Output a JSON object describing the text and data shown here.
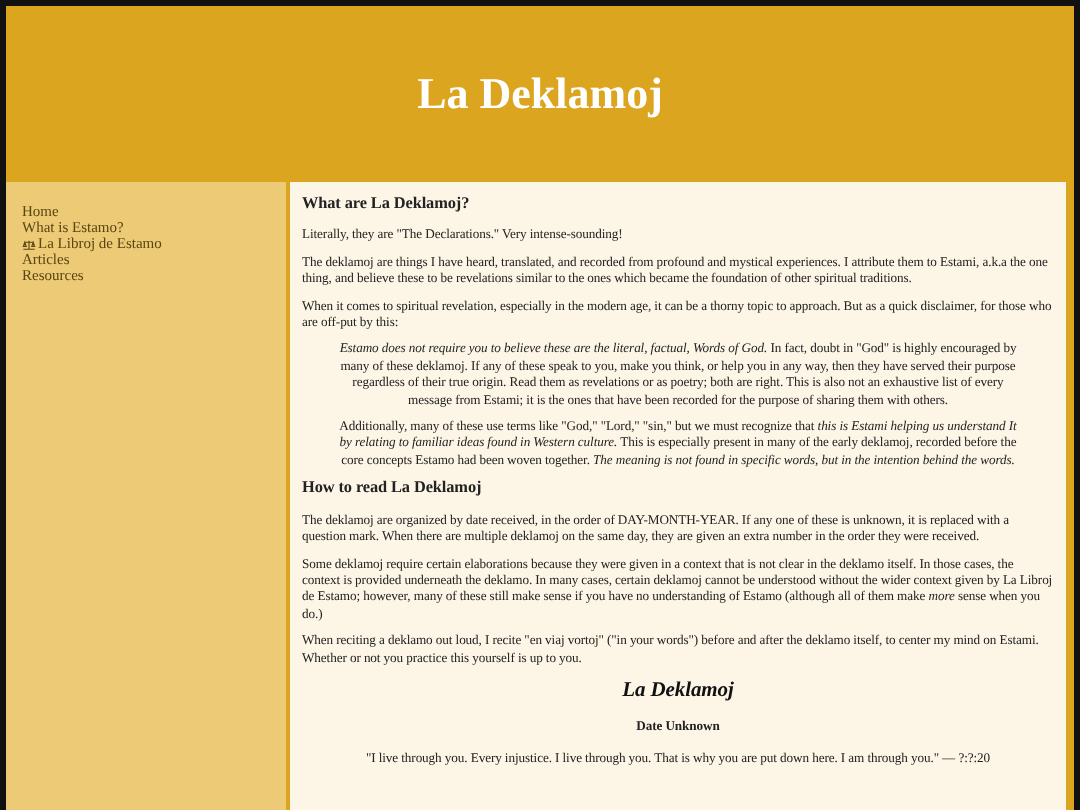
{
  "header": {
    "title": "La Deklamoj"
  },
  "sidebar": {
    "items": [
      {
        "label": "Home",
        "icon": false
      },
      {
        "label": "What is Estamo?",
        "icon": false
      },
      {
        "label": "La Libroj de Estamo",
        "icon": true
      },
      {
        "label": "Articles",
        "icon": false
      },
      {
        "label": "Resources",
        "icon": false
      }
    ]
  },
  "content": [
    {
      "kind": "heading",
      "text": "What are La Deklamoj?"
    },
    {
      "kind": "para",
      "text": "Literally, they are \"The Declarations.\" Very intense-sounding!"
    },
    {
      "kind": "para",
      "text": "The deklamoj are things I have heard, translated, and recorded from profound and mystical experiences. I attribute them to Estami, a.k.a the one thing, and believe these to be revelations similar to the ones which became the foundation of other spiritual traditions."
    },
    {
      "kind": "para",
      "text": "When it comes to spiritual revelation, especially in the modern age, it can be a thorny topic to approach. But as a quick disclaimer, for those who are off-put by this:"
    },
    {
      "kind": "quote",
      "text": "*Estamo does not require you to believe these are the literal, factual, Words of God.* In fact, doubt in \"God\" is highly encouraged by many of these deklamoj. If any of these speak to you, make you think, or help you in any way, then they have served their purpose regardless of their true origin. Read them as revelations or as poetry; both are right. This is also not an exhaustive list of every message from Estami; it is the ones that have been recorded for the purpose of sharing them with others."
    },
    {
      "kind": "quote",
      "text": "Additionally, many of these use terms like \"God,\" \"Lord,\" \"sin,\" but we must recognize that *this is Estami helping us understand It by relating to familiar ideas found in Western culture.* This is especially present in many of the early deklamoj, recorded before the core concepts Estamo had been woven together. *The meaning is not found in specific words, but in the intention behind the words.*"
    },
    {
      "kind": "heading",
      "text": "How to read La Deklamoj"
    },
    {
      "kind": "para",
      "text": "The deklamoj are organized by date received, in the order of DAY-MONTH-YEAR. If any one of these is unknown, it is replaced with a question mark. When there are multiple deklamoj on the same day, they are given an extra number in the order they were received."
    },
    {
      "kind": "para",
      "text": "Some deklamoj require certain elaborations because they were given in a context that is not clear in the deklamo itself. In those cases, the context is provided underneath the deklamo. In many cases, certain deklamoj cannot be understood without the wider context given by La Libroj de Estamo; however, many of these still make sense if you have no understanding of Estamo (although all of them make *more* sense when you do.)"
    },
    {
      "kind": "para",
      "text": "When reciting a deklamo out loud, I recite \"en viaj vortoj\" (\"in your words\") before and after the deklamo itself, to center my mind on Estami. Whether or not you practice this yourself is up to you."
    },
    {
      "kind": "title",
      "text": "La Deklamoj"
    },
    {
      "kind": "date",
      "text": "Date Unknown"
    },
    {
      "kind": "entry",
      "text": "\"I live through you. Every injustice. I live through you. That is why you are put down here. I am through you.\" — ?:?:20"
    }
  ]
}
